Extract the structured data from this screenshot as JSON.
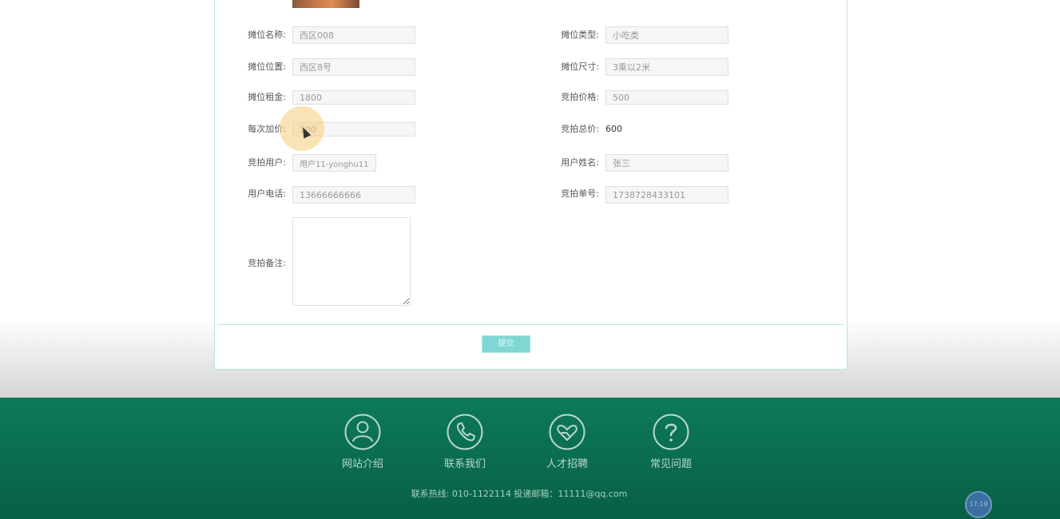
{
  "form": {
    "fields": [
      {
        "label": "摊位名称:",
        "value": "西区008"
      },
      {
        "label": "摊位类型:",
        "value": "小吃类"
      },
      {
        "label": "摊位位置:",
        "value": "西区8号"
      },
      {
        "label": "摊位尺寸:",
        "value": "3乘以2米"
      },
      {
        "label": "摊位租金:",
        "value": "1800"
      },
      {
        "label": "竞拍价格:",
        "value": "500"
      },
      {
        "label": "每次加价:",
        "value": "100"
      },
      {
        "label": "竞拍总价:",
        "value": "600"
      },
      {
        "label": "竞拍用户:",
        "value": "用户11-yonghu11"
      },
      {
        "label": "用户姓名:",
        "value": "张三"
      },
      {
        "label": "用户电话:",
        "value": "13666666666"
      },
      {
        "label": "竞拍单号:",
        "value": "1738728433101"
      },
      {
        "label": "竞拍备注:",
        "value": ""
      }
    ],
    "submit_label": "提交"
  },
  "footer": {
    "links": [
      {
        "label": "网站介绍",
        "icon": "user-icon"
      },
      {
        "label": "联系我们",
        "icon": "phone-icon"
      },
      {
        "label": "人才招聘",
        "icon": "heart-hands-icon"
      },
      {
        "label": "常见问题",
        "icon": "question-icon"
      }
    ],
    "contact": "联系热线: 010-1122114 投递邮箱：11111@qq.com"
  },
  "clock": "17:19",
  "colors": {
    "accent": "#7fd6d3",
    "footer": "#0a6a4e",
    "border": "#b5e7e2"
  }
}
